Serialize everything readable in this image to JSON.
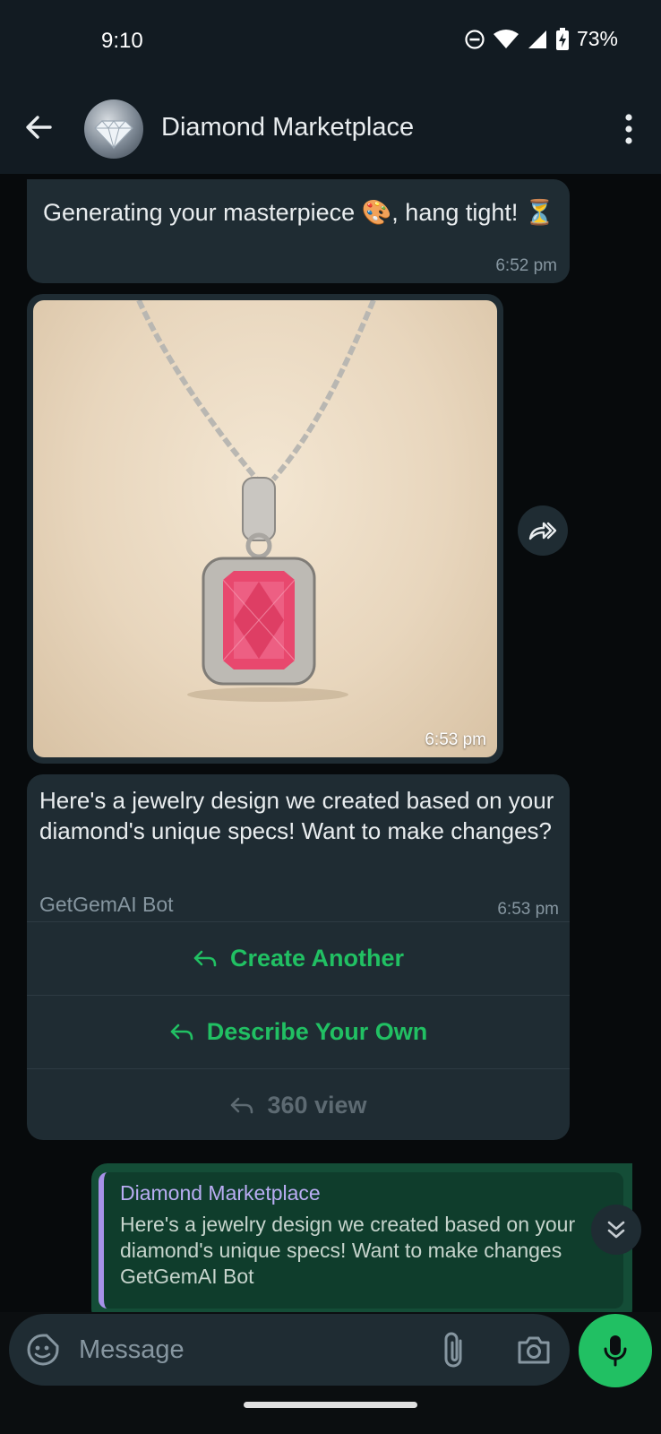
{
  "status_bar": {
    "time": "9:10",
    "battery_percent": "73%",
    "icons": [
      "do-not-disturb-icon",
      "wifi-icon",
      "signal-icon",
      "battery-charging-icon"
    ]
  },
  "header": {
    "title": "Diamond Marketplace",
    "avatar_icon": "diamond-icon",
    "back_icon": "arrow-left-icon",
    "menu_icon": "more-vertical-icon"
  },
  "messages": [
    {
      "text": "Generating your masterpiece 🎨, hang tight! ⏳",
      "time": "6:52 pm"
    },
    {
      "type": "image",
      "image_description": "pink-diamond-pendant",
      "time": "6:53 pm"
    },
    {
      "text": "Here's a jewelry design we created based on your diamond's unique specs! Want to make changes?",
      "footer": "GetGemAI Bot",
      "time": "6:53 pm",
      "buttons": [
        {
          "label": "Create Another",
          "enabled": true
        },
        {
          "label": "Describe Your Own",
          "enabled": true
        },
        {
          "label": "360 view",
          "enabled": false
        }
      ]
    },
    {
      "quoted_title": "Diamond Marketplace",
      "quoted_text": "Here's a jewelry design we created based on your diamond's unique specs! Want to make changes",
      "quoted_footer": "GetGemAI Bot"
    }
  ],
  "input": {
    "placeholder": "Message"
  },
  "colors": {
    "accent_green": "#21c063",
    "bubble_incoming": "#1f2c33",
    "bubble_outgoing": "#144d37",
    "quote_bar": "#a791e8"
  }
}
